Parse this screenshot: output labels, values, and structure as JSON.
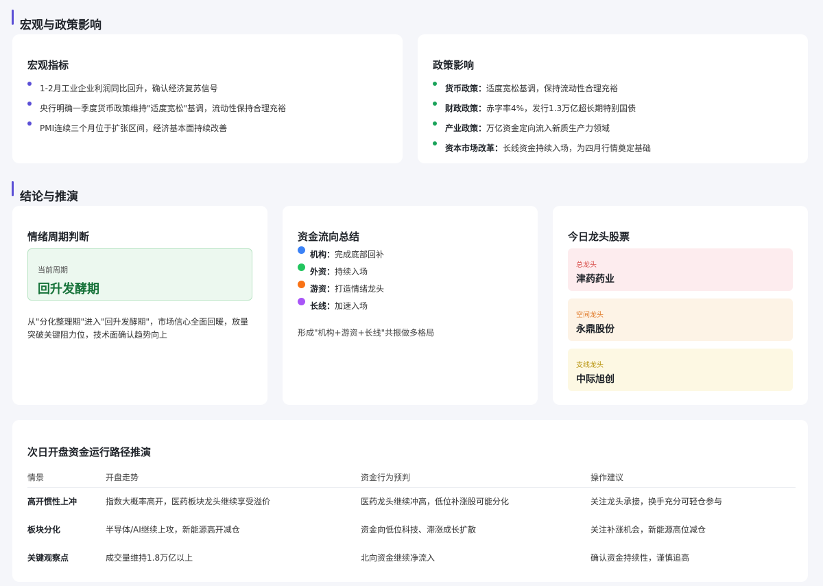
{
  "sections": {
    "macro_policy_title": "宏观与政策影响",
    "conclusion_title": "结论与推演"
  },
  "macro": {
    "title": "宏观指标",
    "items": [
      "1-2月工业企业利润同比回升，确认经济复苏信号",
      "央行明确一季度货币政策维持\"适度宽松\"基调，流动性保持合理充裕",
      "PMI连续三个月位于扩张区间，经济基本面持续改善"
    ],
    "dot_color": "#5b4fd6"
  },
  "policy": {
    "title": "政策影响",
    "items": [
      {
        "label": "货币政策：",
        "text": "适度宽松基调，保持流动性合理充裕"
      },
      {
        "label": "财政政策：",
        "text": "赤字率4%，发行1.3万亿超长期特别国债"
      },
      {
        "label": "产业政策：",
        "text": "万亿资金定向流入新质生产力领域"
      },
      {
        "label": "资本市场改革：",
        "text": "长线资金持续入场，为四月行情奠定基础"
      }
    ],
    "dot_color": "#1aa35a"
  },
  "sentiment": {
    "title": "情绪周期判断",
    "current_label": "当前周期",
    "current_value": "回升发酵期",
    "description": "从\"分化整理期\"进入\"回升发酵期\"，市场信心全面回暖，放量突破关键阻力位，技术面确认趋势向上"
  },
  "fund_flow": {
    "title": "资金流向总结",
    "items": [
      {
        "label": "机构：",
        "text": "完成底部回补",
        "color": "#3b82f6"
      },
      {
        "label": "外资：",
        "text": "持续入场",
        "color": "#22c55e"
      },
      {
        "label": "游资：",
        "text": "打造情绪龙头",
        "color": "#f97316"
      },
      {
        "label": "长线：",
        "text": "加速入场",
        "color": "#a855f7"
      }
    ],
    "summary": "形成\"机构+游资+长线\"共振做多格局"
  },
  "dragons": {
    "title": "今日龙头股票",
    "items": [
      {
        "tag": "总龙头",
        "name": "津药药业",
        "bg": "#fdecee",
        "tag_color": "#d9534f"
      },
      {
        "tag": "空间龙头",
        "name": "永鼎股份",
        "bg": "#fdf3e6",
        "tag_color": "#e07b2a"
      },
      {
        "tag": "支线龙头",
        "name": "中际旭创",
        "bg": "#fdf8e3",
        "tag_color": "#b8940e"
      }
    ]
  },
  "path": {
    "title": "次日开盘资金运行路径推演",
    "headers": [
      "情景",
      "开盘走势",
      "资金行为预判",
      "操作建议"
    ],
    "rows": [
      [
        "高开惯性上冲",
        "指数大概率高开，医药板块龙头继续享受溢价",
        "医药龙头继续冲高，低位补涨股可能分化",
        "关注龙头承接，换手充分可轻仓参与"
      ],
      [
        "板块分化",
        "半导体/AI继续上攻，新能源高开减仓",
        "资金向低位科技、滞涨成长扩散",
        "关注补涨机会，新能源高位减仓"
      ],
      [
        "关键观察点",
        "成交量维持1.8万亿以上",
        "北向资金继续净流入",
        "确认资金持续性，谨慎追高"
      ]
    ]
  }
}
